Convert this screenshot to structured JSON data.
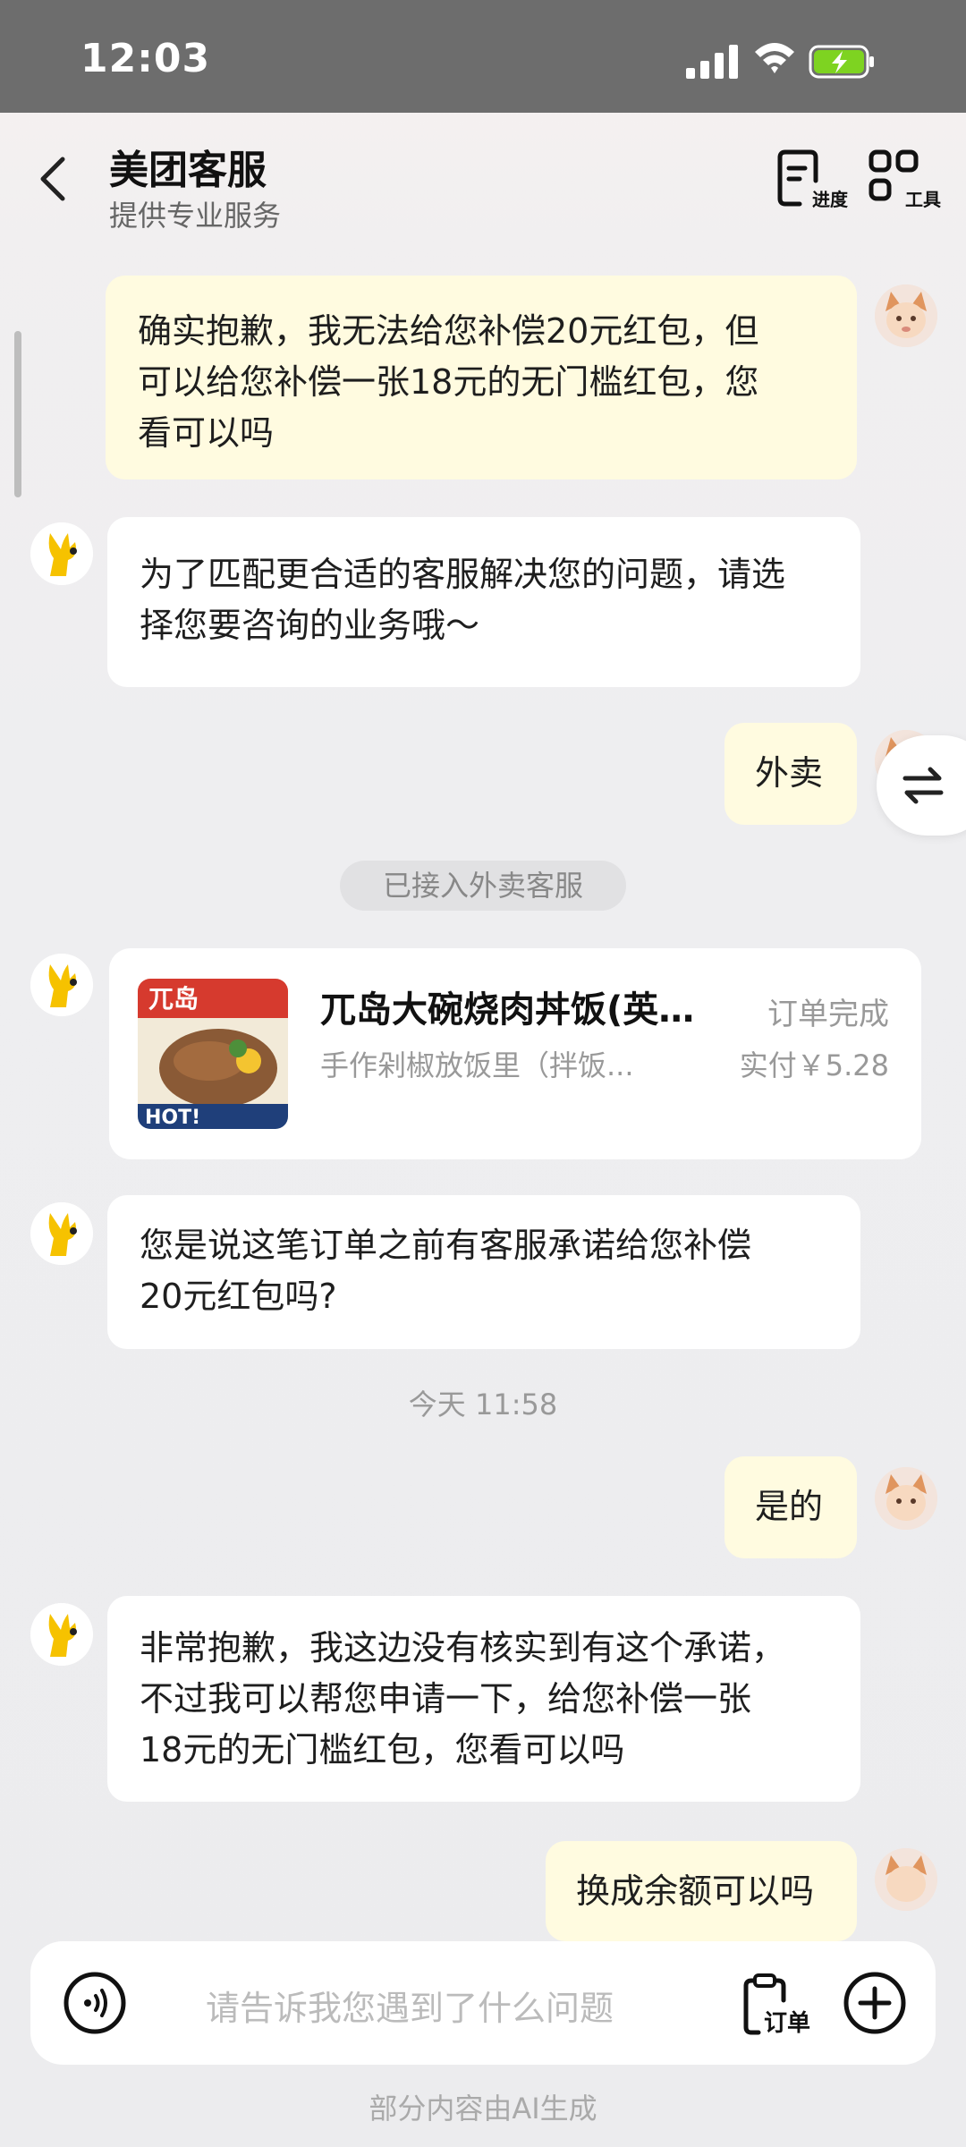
{
  "status_bar": {
    "time": "12:03",
    "battery_state": "charging"
  },
  "header": {
    "title": "美团客服",
    "subtitle": "提供专业服务",
    "progress_label": "进度",
    "tools_label": "工具"
  },
  "messages": {
    "m1": {
      "sender": "user",
      "lines": [
        "确实抱歉，我无法给您补偿20元红包，但",
        "可以给您补偿一张18元的无门槛红包，您",
        "看可以吗"
      ]
    },
    "m2": {
      "sender": "bot",
      "lines": [
        "为了匹配更合适的客服解决您的问题，请选",
        "择您要咨询的业务哦～"
      ]
    },
    "m3": {
      "sender": "user",
      "text": "外卖"
    },
    "system_notice": "已接入外卖客服",
    "order_card": {
      "name": "兀岛大碗烧肉丼饭(英...",
      "status": "订单完成",
      "sub": "手作剁椒放饭里（拌饭...",
      "paid": "实付￥5.28",
      "image_brand": "兀岛",
      "image_badge": "HOT!"
    },
    "m4": {
      "sender": "bot",
      "lines": [
        "您是说这笔订单之前有客服承诺给您补偿",
        "20元红包吗?"
      ]
    },
    "time_label": "今天 11:58",
    "m5": {
      "sender": "user",
      "text": "是的"
    },
    "m6": {
      "sender": "bot",
      "lines": [
        "非常抱歉，我这边没有核实到有这个承诺，",
        "不过我可以帮您申请一下，给您补偿一张",
        "18元的无门槛红包，您看可以吗"
      ]
    },
    "m7": {
      "sender": "user",
      "text": "换成余额可以吗"
    }
  },
  "input_bar": {
    "placeholder": "请告诉我您遇到了什么问题",
    "order_label": "订单"
  },
  "footer_note": "部分内容由AI生成",
  "colors": {
    "user_bubble": "#fffbe0",
    "bot_bubble": "#ffffff",
    "status_bar": "#6d6d6d",
    "bot_avatar": "#f6c200",
    "battery_charge": "#7ed321"
  }
}
